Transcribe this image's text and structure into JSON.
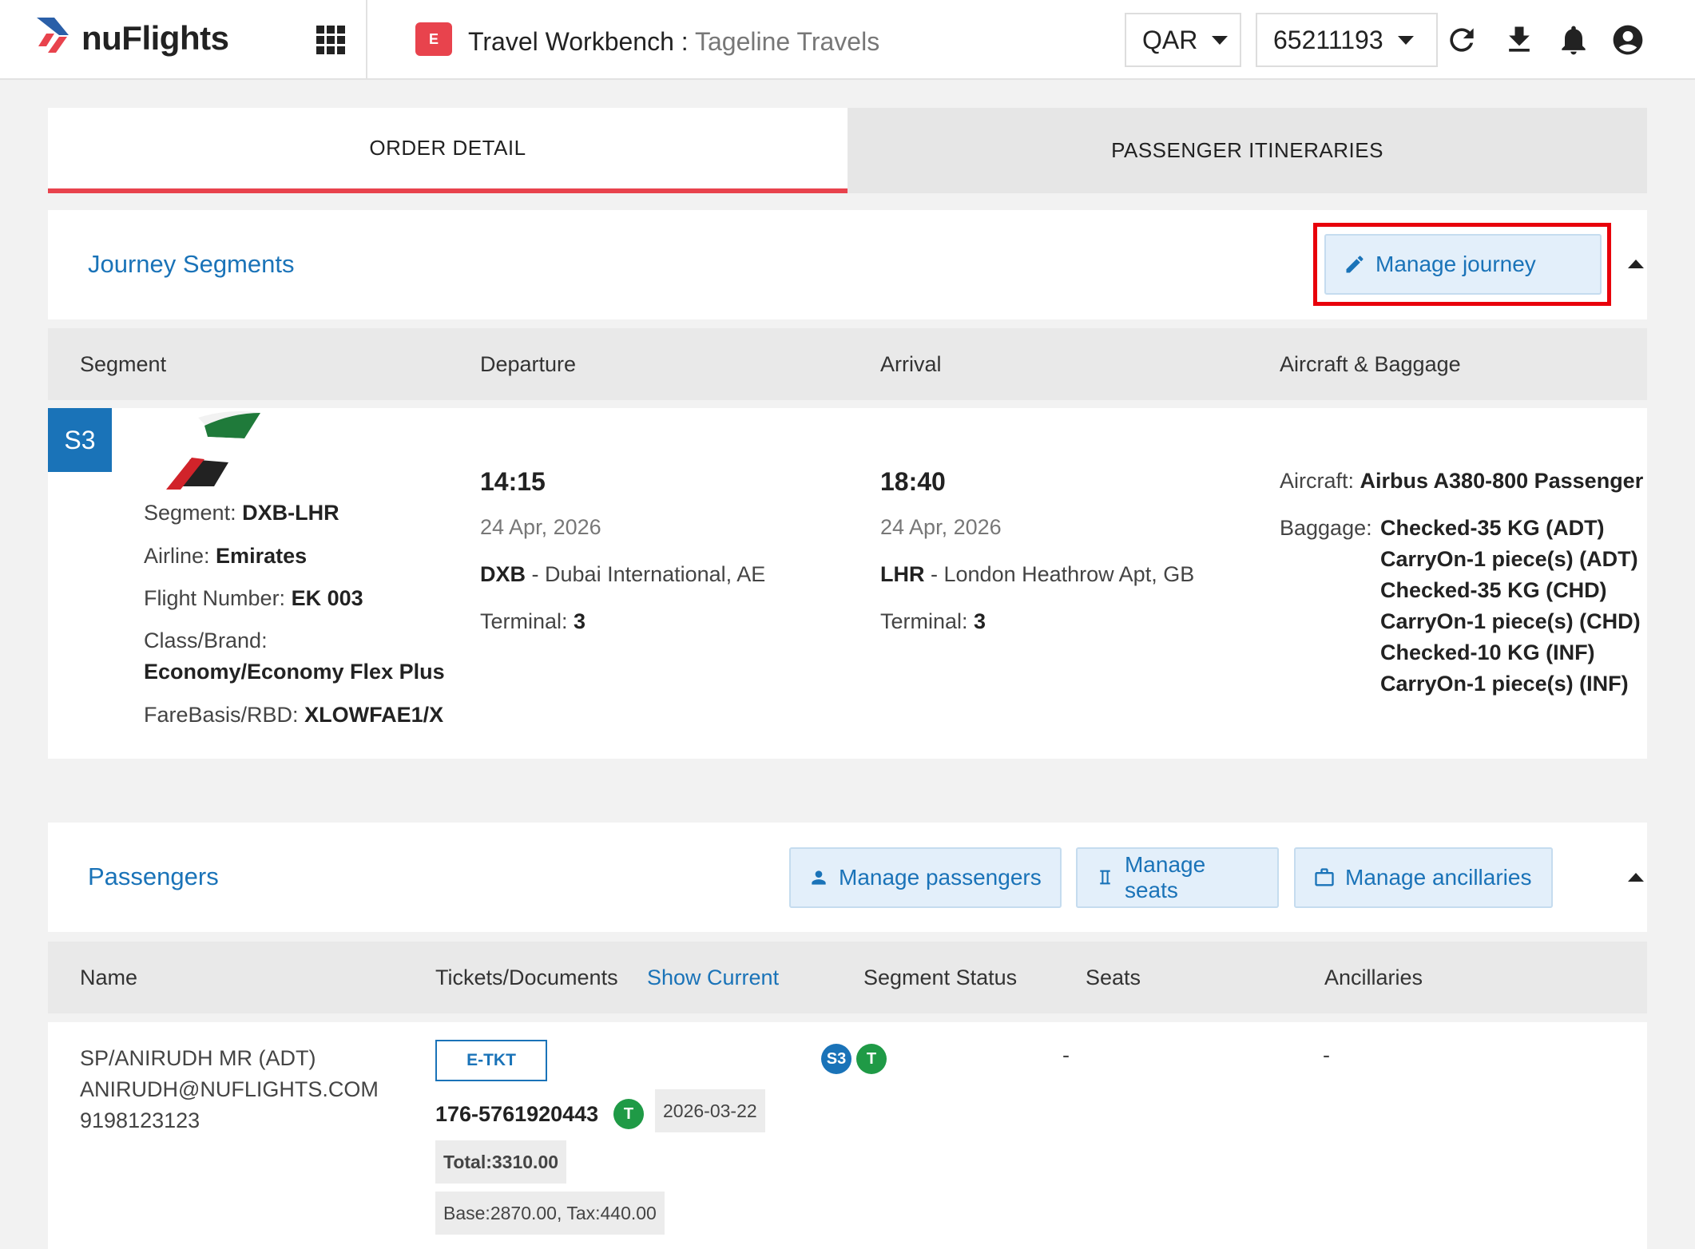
{
  "header": {
    "logo_text": "nuFlights",
    "workbench_icon_text": "E",
    "title": "Travel Workbench :",
    "subtitle": "Tageline Travels",
    "currency": "QAR",
    "account": "65211193"
  },
  "tabs": [
    {
      "label": "ORDER DETAIL",
      "active": true
    },
    {
      "label": "PASSENGER ITINERARIES",
      "active": false
    }
  ],
  "journey": {
    "title": "Journey Segments",
    "manage_label": "Manage journey",
    "columns": [
      "Segment",
      "Departure",
      "Arrival",
      "Aircraft & Baggage"
    ],
    "segment": {
      "badge": "S3",
      "segment_label": "Segment:",
      "segment_value": "DXB-LHR",
      "airline_label": "Airline:",
      "airline_value": "Emirates",
      "flight_label": "Flight Number:",
      "flight_value": "EK 003",
      "class_label": "Class/Brand:",
      "class_value": "Economy/Economy Flex Plus",
      "fare_label": "FareBasis/RBD:",
      "fare_value": "XLOWFAE1/X"
    },
    "departure": {
      "time": "14:15",
      "date": "24 Apr, 2026",
      "code": "DXB",
      "airport": "- Dubai International, AE",
      "terminal_label": "Terminal:",
      "terminal": "3"
    },
    "arrival": {
      "time": "18:40",
      "date": "24 Apr, 2026",
      "code": "LHR",
      "airport": "- London Heathrow Apt, GB",
      "terminal_label": "Terminal:",
      "terminal": "3"
    },
    "aircraft": {
      "aircraft_label": "Aircraft:",
      "aircraft_value": "Airbus A380-800 Passenger",
      "baggage_label": "Baggage:",
      "baggage": [
        "Checked-35 KG (ADT)",
        "CarryOn-1 piece(s) (ADT)",
        "Checked-35 KG (CHD)",
        "CarryOn-1 piece(s) (CHD)",
        "Checked-10 KG (INF)",
        "CarryOn-1 piece(s) (INF)"
      ]
    }
  },
  "passengers": {
    "title": "Passengers",
    "manage_passengers": "Manage passengers",
    "manage_seats": "Manage seats",
    "manage_ancillaries": "Manage ancillaries",
    "col_name": "Name",
    "col_tickets": "Tickets/Documents",
    "show_current": "Show Current",
    "col_status": "Segment Status",
    "col_seats": "Seats",
    "col_ancillaries": "Ancillaries",
    "row": {
      "name": "SP/ANIRUDH MR (ADT)",
      "email": "ANIRUDH@NUFLIGHTS.COM",
      "phone": "9198123123",
      "doc_type": "E-TKT",
      "ticket_number": "176-5761920443",
      "ticket_status": "T",
      "ticket_date": "2026-03-22",
      "total": "Total:3310.00",
      "base_tax": "Base:2870.00, Tax:440.00",
      "segment_badge": "S3",
      "segment_status": "T",
      "seats": "-",
      "ancillaries": "-"
    }
  },
  "colors": {
    "brand_red": "#e8434d",
    "link_blue": "#1a73b8",
    "status_green": "#1f9a46",
    "highlight": "#e8000b"
  }
}
